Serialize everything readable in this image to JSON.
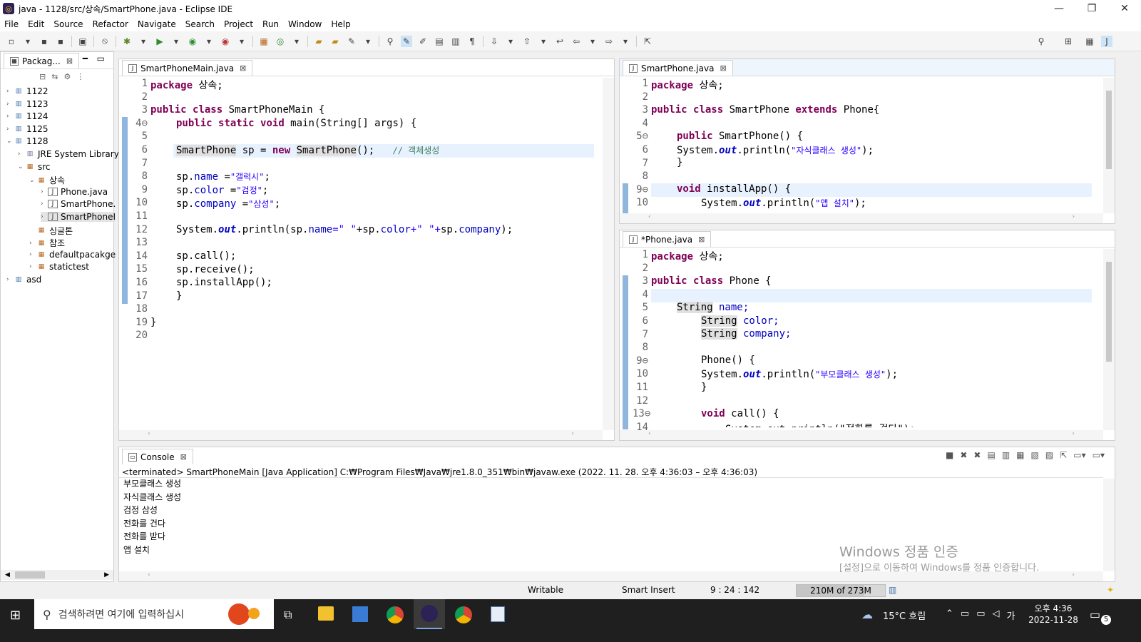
{
  "window": {
    "title": "java - 1128/src/상속/SmartPhone.java - Eclipse IDE",
    "minimize": "—",
    "maximize": "❐",
    "close": "✕"
  },
  "menu": [
    "File",
    "Edit",
    "Source",
    "Refactor",
    "Navigate",
    "Search",
    "Project",
    "Run",
    "Window",
    "Help"
  ],
  "explorer": {
    "tab_label": "Packag...",
    "items": [
      {
        "label": "1122",
        "indent": 0,
        "arrow": "›",
        "icon": "project"
      },
      {
        "label": "1123",
        "indent": 0,
        "arrow": "›",
        "icon": "project"
      },
      {
        "label": "1124",
        "indent": 0,
        "arrow": "›",
        "icon": "project"
      },
      {
        "label": "1125",
        "indent": 0,
        "arrow": "›",
        "icon": "project"
      },
      {
        "label": "1128",
        "indent": 0,
        "arrow": "⌄",
        "icon": "project"
      },
      {
        "label": "JRE System Library",
        "indent": 1,
        "arrow": "›",
        "icon": "library"
      },
      {
        "label": "src",
        "indent": 1,
        "arrow": "⌄",
        "icon": "folder"
      },
      {
        "label": "상속",
        "indent": 2,
        "arrow": "⌄",
        "icon": "package"
      },
      {
        "label": "Phone.java",
        "indent": 3,
        "arrow": "›",
        "icon": "java-file"
      },
      {
        "label": "SmartPhone.",
        "indent": 3,
        "arrow": "›",
        "icon": "java-file"
      },
      {
        "label": "SmartPhoneI",
        "indent": 3,
        "arrow": "›",
        "icon": "java-file"
      },
      {
        "label": "싱글톤",
        "indent": 2,
        "arrow": "",
        "icon": "package"
      },
      {
        "label": "참조",
        "indent": 2,
        "arrow": "›",
        "icon": "package"
      },
      {
        "label": "defaultpacakge",
        "indent": 2,
        "arrow": "›",
        "icon": "package"
      },
      {
        "label": "statictest",
        "indent": 2,
        "arrow": "›",
        "icon": "package"
      },
      {
        "label": "asd",
        "indent": 0,
        "arrow": "›",
        "icon": "project"
      }
    ]
  },
  "editor_main": {
    "tab_label": "SmartPhoneMain.java",
    "line_numbers": [
      "1",
      "2",
      "3",
      "4⊖",
      "5",
      "6",
      "7",
      "8",
      "9",
      "10",
      "11",
      "12",
      "13",
      "14",
      "15",
      "16",
      "17",
      "18",
      "19",
      "20"
    ]
  },
  "editor_smartphone": {
    "tab_label": "SmartPhone.java",
    "line_numbers": [
      "1",
      "2",
      "3",
      "4",
      "5⊖",
      "6",
      "7",
      "8",
      "9⊖",
      "10"
    ]
  },
  "editor_phone": {
    "tab_label": "*Phone.java",
    "line_numbers": [
      "1",
      "2",
      "3",
      "4",
      "5",
      "6",
      "7",
      "8",
      "9⊖",
      "10",
      "11",
      "12",
      "13⊖",
      "14"
    ]
  },
  "code": {
    "package_kw": "package",
    "package_name": " 상속;",
    "public": "public",
    "class": "class",
    "static": "static",
    "void": "void",
    "new": "new",
    "extends": "extends",
    "String_type": "String",
    "out": "out",
    "main_classname": " SmartPhoneMain {",
    "main_sig": " main(String[] args) {",
    "main_l6_a": "SmartPhone",
    "main_l6_b": " sp = ",
    "main_l6_c": " ",
    "main_l6_d": "SmartPhone",
    "main_l6_e": "();   ",
    "main_l6_cmt": "// 객체생성",
    "sp": "sp.",
    "name": "name",
    "color": "color",
    "company": "company",
    "eq_space": " =",
    "eq": " =",
    "str_galaxy": "\"갤럭시\"",
    "str_black": "\"검정\"",
    "str_samsung": "\"삼성\"",
    "semi": ";",
    "sysout": "System.",
    "println_open": ".println(",
    "plus_space_str": "+\" \"+",
    "str_space_open": "=\" \"",
    "close_paren_semi": ");",
    "call": "sp.call();",
    "receive": "sp.receive();",
    "install": "sp.installApp();",
    "brace_close": "}",
    "sp_classname": " SmartPhone ",
    "sp_parent": " Phone{",
    "sp_ctor": " SmartPhone() {",
    "str_child": "\"자식클래스 생성\"",
    "sp_install_sig": " installApp() {",
    "str_install": "\"앱 설치\"",
    "ph_classname": " Phone {",
    "semi_name": " name;",
    "semi_color": " color;",
    "semi_company": " company;",
    "ph_ctor": "Phone() {",
    "str_parent": "\"부모클래스 생성\"",
    "ph_call_sig": " call() {",
    "ph_l14": "System.out.println(\"전화를 걸다\");"
  },
  "console": {
    "tab_label": "Console",
    "header": "<terminated> SmartPhoneMain [Java Application] C:₩Program Files₩Java₩jre1.8.0_351₩bin₩javaw.exe  (2022. 11. 28. 오후 4:36:03 – 오후 4:36:03)",
    "lines": [
      "부모클래스 생성",
      "자식클래스 생성",
      " 검정 삼성",
      "전화를 건다",
      "전화를 받다",
      "앱 설치"
    ]
  },
  "watermark": {
    "line1": "Windows 정품 인증",
    "line2": "[설정]으로 이동하여 Windows를 정품 인증합니다."
  },
  "status": {
    "writable": "Writable",
    "insert": "Smart Insert",
    "position": "9 : 24 : 142",
    "memory": "210M of 273M"
  },
  "taskbar": {
    "search_placeholder": "검색하려면 여기에 입력하십시",
    "weather": "15°C  흐림",
    "ime": "가",
    "time": "오후 4:36",
    "date": "2022-11-28",
    "notif_count": "5"
  },
  "colors": {
    "accent": "#0078d7",
    "keyword": "#7f0055",
    "string": "#2a00ff",
    "field": "#0000c0",
    "comment": "#3f7f5f"
  }
}
